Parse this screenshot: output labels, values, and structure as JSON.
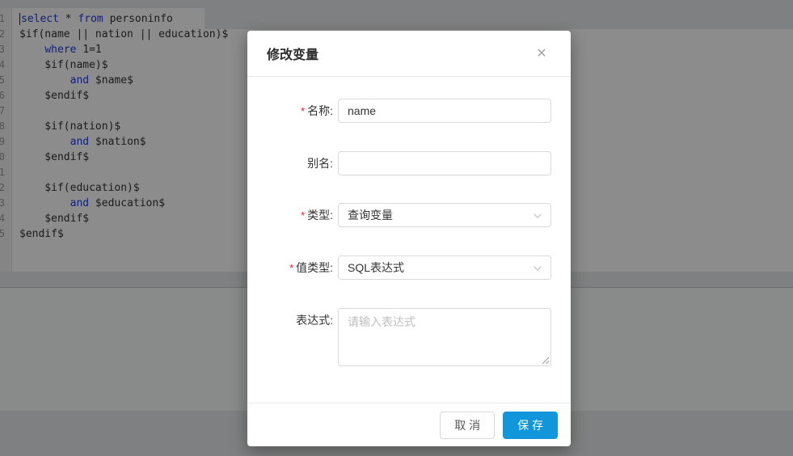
{
  "editor": {
    "colors": {
      "keyword": "#2239e0",
      "text": "#333333"
    },
    "lines": [
      {
        "num": "1",
        "cursor": true,
        "segments": [
          [
            "select",
            "kw"
          ],
          [
            " * ",
            "pl"
          ],
          [
            "from",
            "kw"
          ],
          [
            " personinfo",
            "pl"
          ]
        ]
      },
      {
        "num": "2",
        "segments": [
          [
            "$if(name || nation || education)$",
            "pl"
          ]
        ]
      },
      {
        "num": "3",
        "segments": [
          [
            "    ",
            "pl"
          ],
          [
            "where",
            "kw"
          ],
          [
            " 1=1",
            "pl"
          ]
        ]
      },
      {
        "num": "4",
        "segments": [
          [
            "    $if(name)$",
            "pl"
          ]
        ]
      },
      {
        "num": "5",
        "segments": [
          [
            "        ",
            "pl"
          ],
          [
            "and",
            "kw"
          ],
          [
            " $name$",
            "pl"
          ]
        ]
      },
      {
        "num": "6",
        "segments": [
          [
            "    $endif$",
            "pl"
          ]
        ]
      },
      {
        "num": "7",
        "segments": []
      },
      {
        "num": "8",
        "segments": [
          [
            "    $if(nation)$",
            "pl"
          ]
        ]
      },
      {
        "num": "9",
        "segments": [
          [
            "        ",
            "pl"
          ],
          [
            "and",
            "kw"
          ],
          [
            " $nation$",
            "pl"
          ]
        ]
      },
      {
        "num": "10",
        "segments": [
          [
            "    $endif$",
            "pl"
          ]
        ]
      },
      {
        "num": "11",
        "segments": []
      },
      {
        "num": "12",
        "segments": [
          [
            "    $if(education)$",
            "pl"
          ]
        ]
      },
      {
        "num": "13",
        "segments": [
          [
            "        ",
            "pl"
          ],
          [
            "and",
            "kw"
          ],
          [
            " $education$",
            "pl"
          ]
        ]
      },
      {
        "num": "14",
        "segments": [
          [
            "    $endif$",
            "pl"
          ]
        ]
      },
      {
        "num": "15",
        "segments": [
          [
            "$endif$",
            "pl"
          ]
        ]
      }
    ]
  },
  "modal": {
    "title": "修改变量",
    "close_icon": "✕",
    "colors": {
      "primary": "#1296db",
      "required": "#f5222d"
    },
    "form": {
      "rows": [
        {
          "label": "名称:",
          "required_mark": "*",
          "type": "input",
          "value": "name"
        },
        {
          "label": "别名:",
          "type": "input",
          "value": ""
        },
        {
          "label": "类型:",
          "required_mark": "*",
          "type": "select",
          "value": "查询变量"
        },
        {
          "label": "值类型:",
          "required_mark": "*",
          "type": "select",
          "value": "SQL表达式"
        },
        {
          "label": "表达式:",
          "type": "textarea",
          "placeholder": "请输入表达式"
        }
      ]
    },
    "footer": {
      "cancel_label": "取 消",
      "save_label": "保 存"
    }
  }
}
